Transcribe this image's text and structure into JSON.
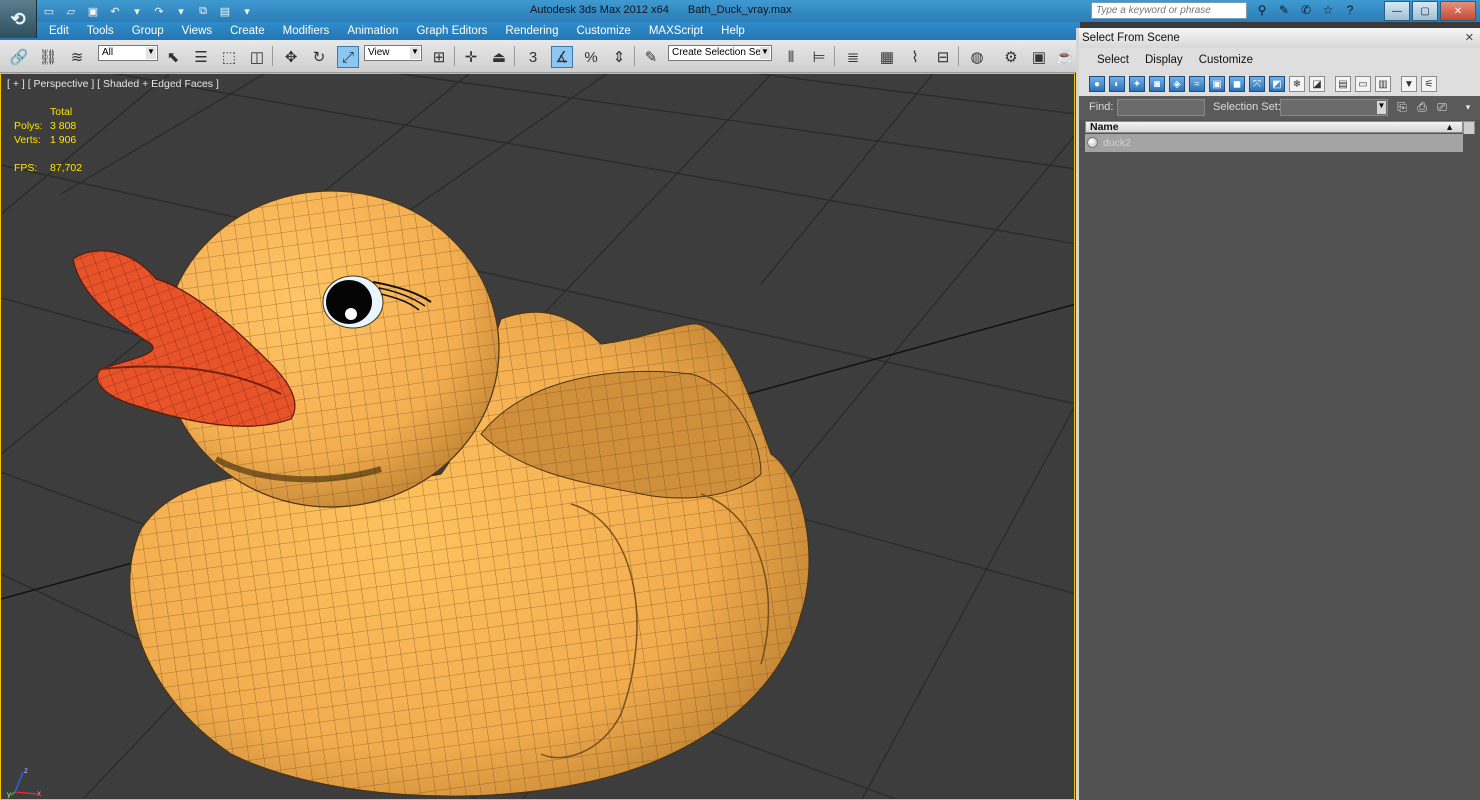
{
  "titlebar": {
    "app_name": "Autodesk 3ds Max  2012 x64",
    "file_name": "Bath_Duck_vray.max",
    "search_placeholder": "Type a keyword or phrase",
    "min_label": "—",
    "max_label": "▢",
    "close_label": "✕"
  },
  "menubar": {
    "items": [
      "Edit",
      "Tools",
      "Group",
      "Views",
      "Create",
      "Modifiers",
      "Animation",
      "Graph Editors",
      "Rendering",
      "Customize",
      "MAXScript",
      "Help"
    ]
  },
  "toolbar": {
    "selection_filter": "All",
    "reference_coord": "View",
    "snap_label": "3",
    "percent_snap_label": "%",
    "named_selection_set": "Create Selection Se"
  },
  "viewport": {
    "label": "[ + ] [ Perspective ] [ Shaded + Edged Faces ]",
    "stats": {
      "total_label": "Total",
      "polys_label": "Polys:",
      "polys_value": "3 808",
      "verts_label": "Verts:",
      "verts_value": "1 906",
      "fps_label": "FPS:",
      "fps_value": "87,702"
    },
    "gizmo": {
      "x": "x",
      "y": "y",
      "z": "z"
    },
    "colors": {
      "background": "#3d3d3d",
      "grid": "#2b2b2b",
      "body": "#f2ac4e",
      "beak": "#e9532a",
      "active_border": "#f2c200"
    }
  },
  "scene_explorer": {
    "title": "Select From Scene",
    "close_label": "✕",
    "menu": [
      "Select",
      "Display",
      "Customize"
    ],
    "find_label": "Find:",
    "find_value": "",
    "selection_set_label": "Selection Set:",
    "selection_set_value": "",
    "column_header": "Name",
    "objects": [
      {
        "name": "duck2",
        "icon": "sphere-object-icon"
      }
    ]
  }
}
